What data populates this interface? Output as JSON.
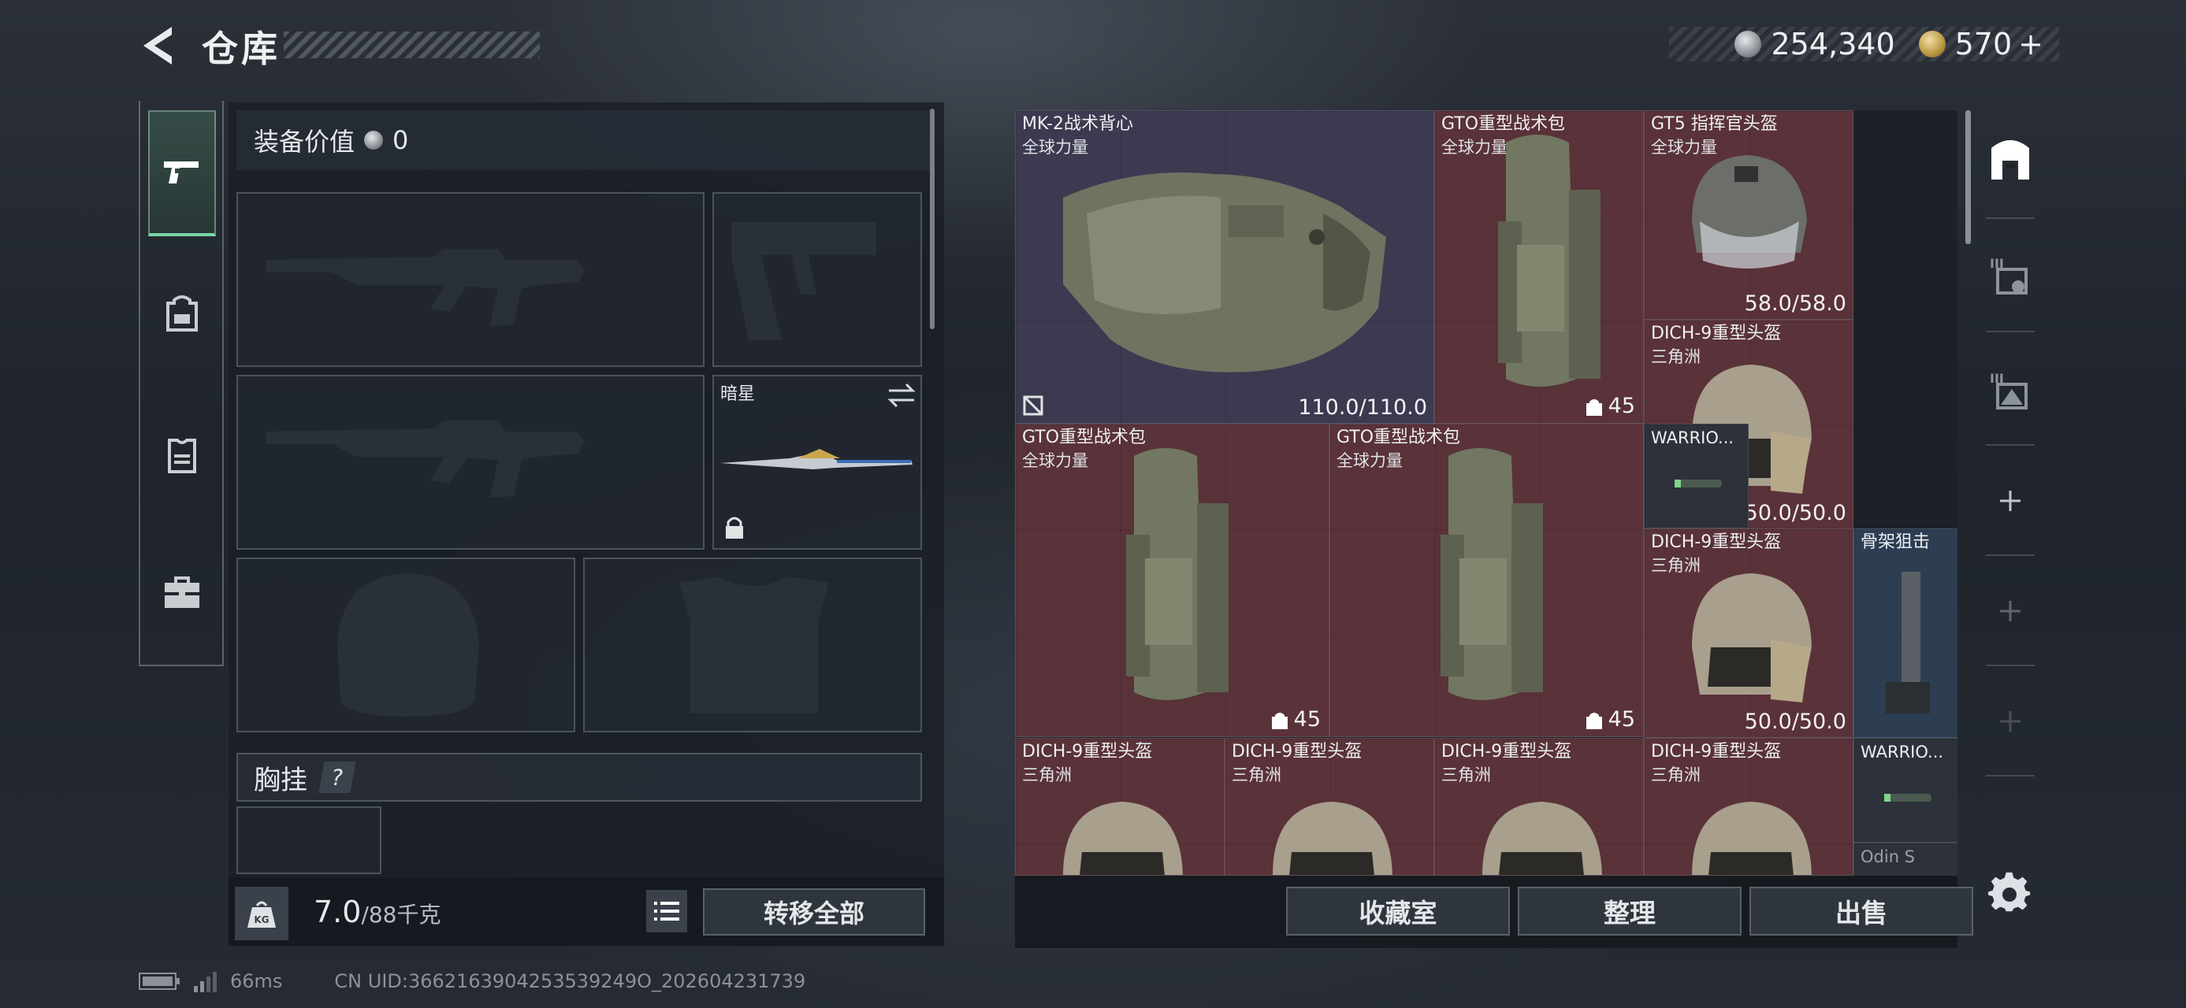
{
  "header": {
    "title": "仓库"
  },
  "currency": {
    "silver": "254,340",
    "gold": "570",
    "gold_add": "+"
  },
  "sidebar": {
    "tabs": [
      {
        "icon": "pistol-icon",
        "active": true
      },
      {
        "icon": "backpack-icon"
      },
      {
        "icon": "vest-icon"
      },
      {
        "icon": "toolbox-icon"
      }
    ]
  },
  "loadout": {
    "equip_value_label": "装备价值",
    "equip_value": "0",
    "melee_name": "暗星",
    "chest_rig_label": "胸挂",
    "chest_rig_help": "?",
    "weight_value": "7.0",
    "weight_max": "/88千克",
    "transfer_all_label": "转移全部"
  },
  "stash": {
    "items": [
      {
        "name": "MK-2战术背心",
        "sub": "全球力量",
        "durability": "110.0/110.0"
      },
      {
        "name": "GTO重型战术包",
        "sub": "全球力量",
        "capacity": "45"
      },
      {
        "name": "GT5 指挥官头盔",
        "sub": "全球力量",
        "durability": "58.0/58.0"
      },
      {
        "name": "DICH-9重型头盔",
        "sub": "三角洲",
        "durability": "50.0/50.0"
      },
      {
        "name": "GTO重型战术包",
        "sub": "全球力量",
        "capacity": "45"
      },
      {
        "name": "GTO重型战术包",
        "sub": "全球力量",
        "capacity": "45"
      },
      {
        "name": "WARRIO..."
      },
      {
        "name": "DICH-9重型头盔",
        "sub": "三角洲",
        "durability": "50.0/50.0"
      },
      {
        "name": "骨架狙击"
      },
      {
        "name": "DICH-9重型头盔",
        "sub": "三角洲"
      },
      {
        "name": "DICH-9重型头盔",
        "sub": "三角洲"
      },
      {
        "name": "DICH-9重型头盔",
        "sub": "三角洲"
      },
      {
        "name": "DICH-9重型头盔",
        "sub": "三角洲"
      },
      {
        "name": "WARRIO..."
      },
      {
        "name": "Odin S"
      }
    ],
    "buttons": {
      "collection": "收藏室",
      "sort": "整理",
      "sell": "出售"
    }
  },
  "status": {
    "ping": "66ms",
    "uid": "CN UID:3662163904253539249O_202604231739"
  },
  "colors": {
    "accent_green": "#79d6a7",
    "rarity_red": "#5a3239",
    "rarity_purple": "#3c3a50",
    "rarity_blue": "#2d3e52"
  }
}
